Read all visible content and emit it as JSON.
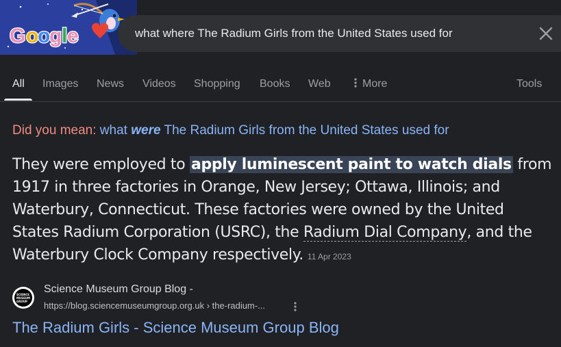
{
  "search": {
    "query": "what where The Radium Girls from the United States used for"
  },
  "tabs": [
    {
      "label": "All",
      "active": true
    },
    {
      "label": "Images"
    },
    {
      "label": "News"
    },
    {
      "label": "Videos"
    },
    {
      "label": "Shopping"
    },
    {
      "label": "Books"
    },
    {
      "label": "Web"
    },
    {
      "label": "More"
    }
  ],
  "tools_label": "Tools",
  "did_you_mean": {
    "label": "Did you mean:",
    "before": "what ",
    "correction": "were",
    "after": " The Radium Girls from the United States used for"
  },
  "snippet": {
    "part1": "They were employed to ",
    "highlight": "apply luminescent paint to watch dials",
    "part2": " from 1917 in three factories in Orange, New Jersey; Ottawa, Illinois; and Waterbury, Connecticut. These factories were owned by the United States Radium Corporation (USRC), the ",
    "link": "Radium Dial Company",
    "part3": ", and the Waterbury Clock Company respectively.",
    "date": "11 Apr 2023"
  },
  "result": {
    "site_name": "Science Museum Group Blog -",
    "url": "https://blog.sciencemuseumgroup.org.uk › the-radium-...",
    "title": "The Radium Girls - Science Museum Group Blog",
    "favicon_text": "SCIENCE\nMUSEUM\nGROUP"
  },
  "doodle": {
    "logo_text": "Google"
  },
  "colors": {
    "background": "#202124",
    "search_box": "#303134",
    "link": "#8ab4f8",
    "did_you_mean": "#f28b82",
    "highlight": "#394457"
  },
  "icons": {
    "clear": "close-icon",
    "more": "more-vert-icon",
    "result_menu": "more-vert-icon"
  }
}
